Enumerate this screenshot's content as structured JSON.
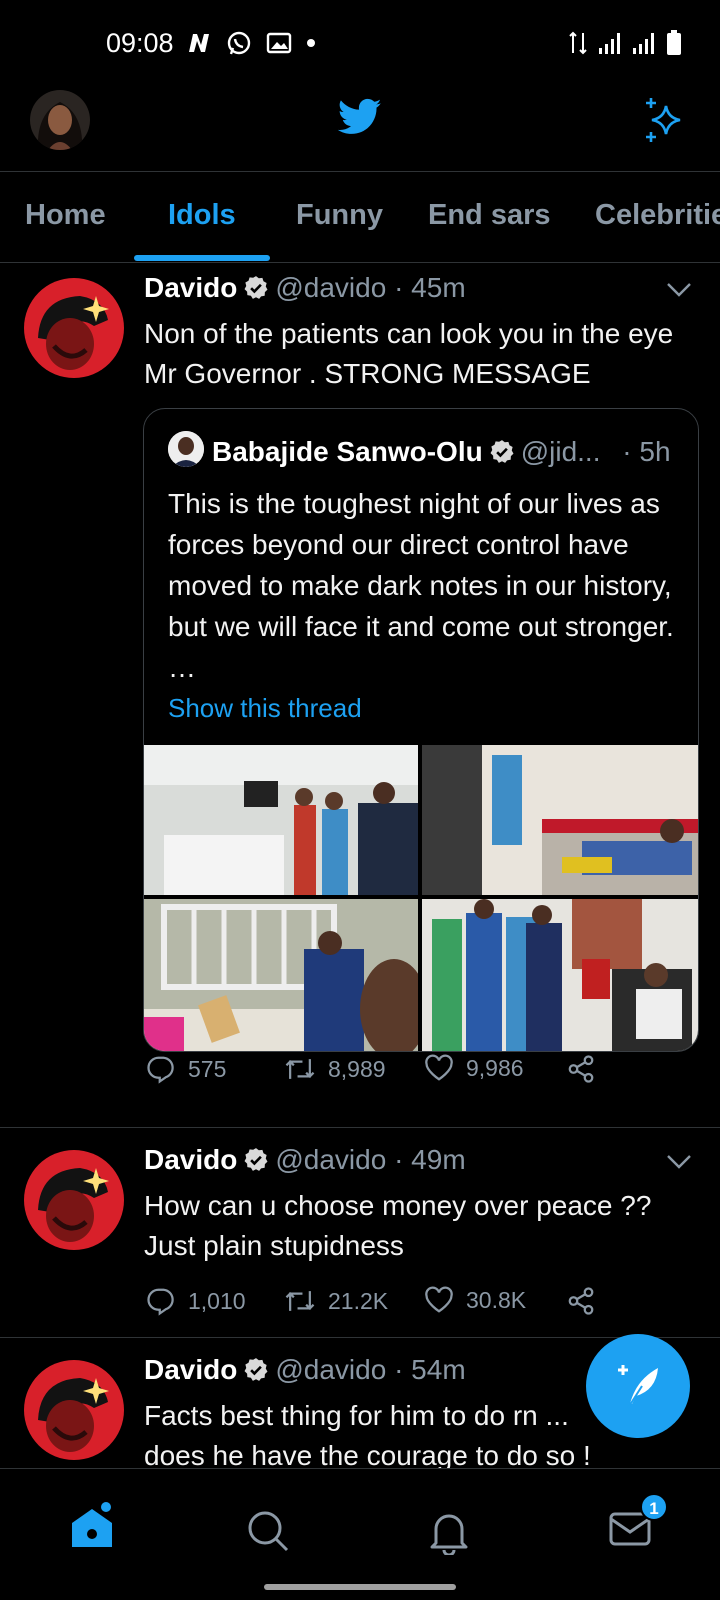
{
  "status_bar": {
    "time": "09:08"
  },
  "tabs": [
    {
      "label": "Home"
    },
    {
      "label": "Idols"
    },
    {
      "label": "Funny"
    },
    {
      "label": "End sars"
    },
    {
      "label": "Celebritie"
    }
  ],
  "tweets": [
    {
      "name": "Davido",
      "handle": "@davido",
      "time": "· 45m",
      "text": "Non of the patients can look you in the eye Mr Governor . STRONG MESSAGE",
      "quote": {
        "name": "Babajide Sanwo-Olu",
        "handle": "@jid...",
        "time": "· 5h",
        "text": "This is the toughest night of our lives as forces beyond our direct control have moved to make dark notes in our history, but we will face it and come out stronger. …",
        "link": "Show this thread"
      },
      "replies": "575",
      "retweets": "8,989",
      "likes": "9,986"
    },
    {
      "name": "Davido",
      "handle": "@davido",
      "time": "· 49m",
      "text": "How can u choose money over peace ?? Just plain stupidness",
      "replies": "1,010",
      "retweets": "21.2K",
      "likes": "30.8K"
    },
    {
      "name": "Davido",
      "handle": "@davido",
      "time": "· 54m",
      "text": "Facts best thing for him to do rn ... does  he have the courage to do so !"
    }
  ],
  "bottom_nav": {
    "items": [
      "home-icon",
      "search-icon",
      "notifications-icon",
      "messages-icon"
    ],
    "messages_badge": "1"
  },
  "colors": {
    "accent": "#1da1f2",
    "background": "#000000",
    "secondary_text": "#8b98a5"
  }
}
